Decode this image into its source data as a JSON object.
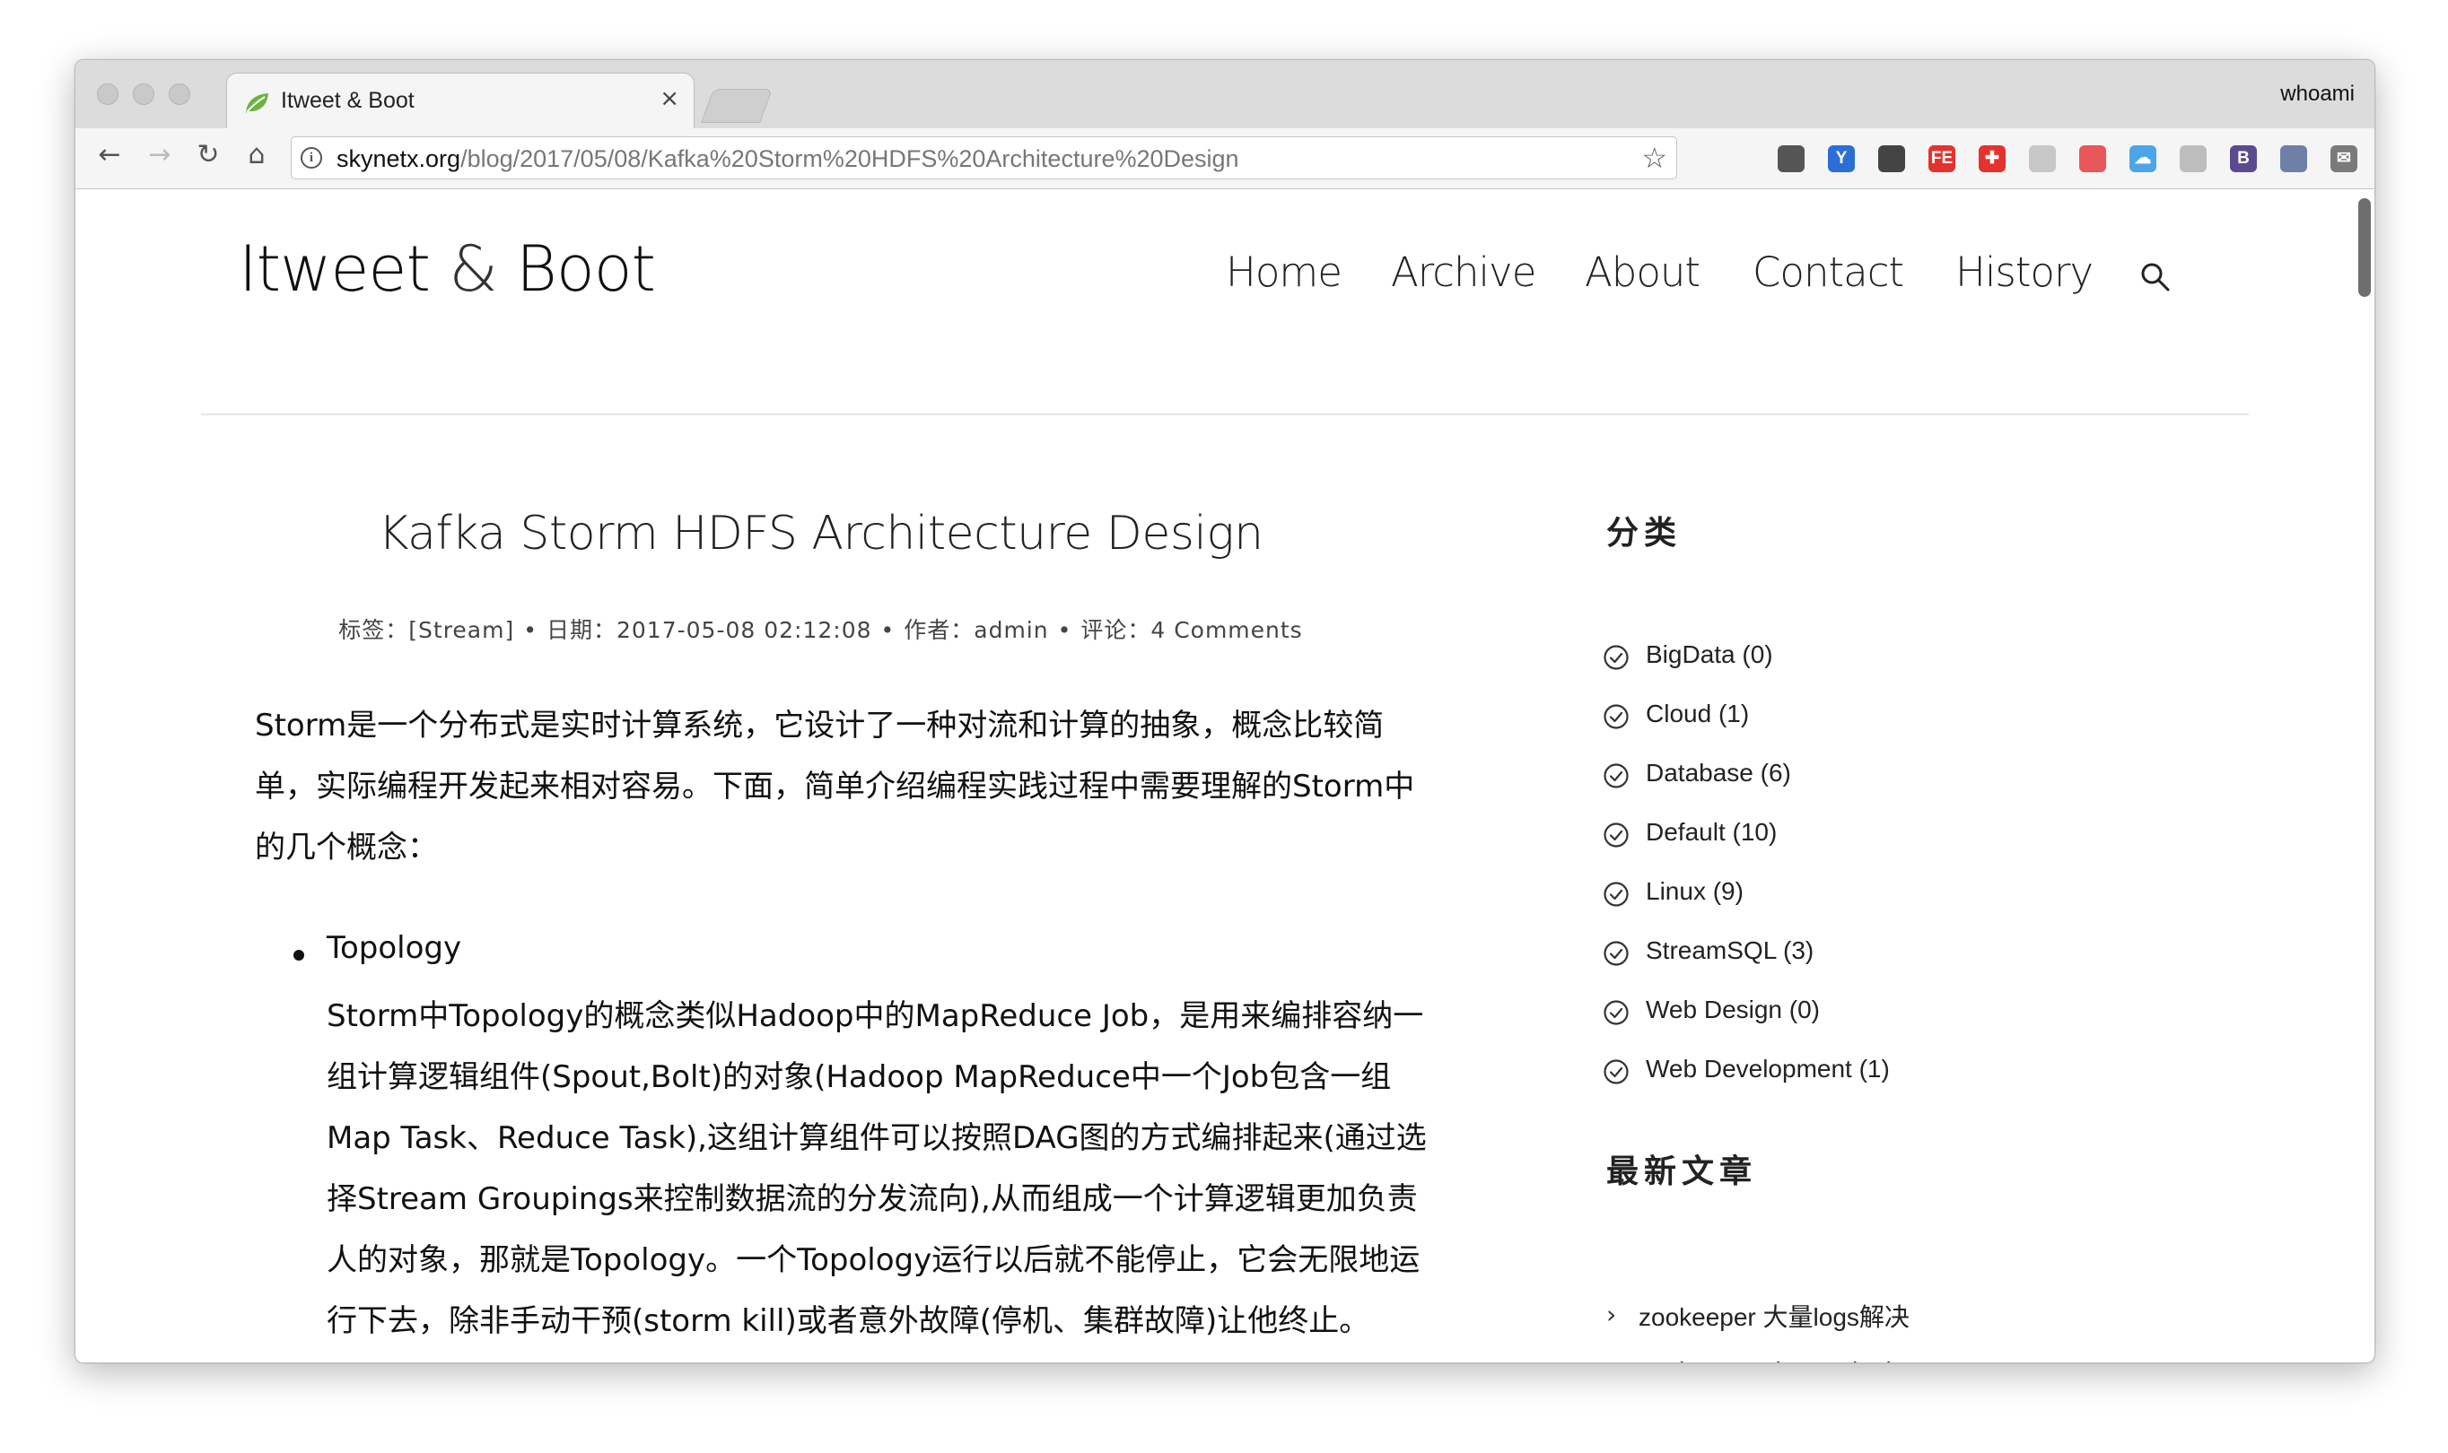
{
  "browser": {
    "tab_title": "Itweet & Boot",
    "tab_close": "×",
    "profile_name": "whoami",
    "url_host": "skynetx.org",
    "url_path": "/blog/2017/05/08/Kafka%20Storm%20HDFS%20Architecture%20Design",
    "back_glyph": "←",
    "forward_glyph": "→",
    "reload_glyph": "↻",
    "home_glyph": "⌂",
    "info_glyph": "i",
    "star_glyph": "☆",
    "extensions": [
      {
        "name": "pocket-extension-icon",
        "label": "",
        "color": "#555555"
      },
      {
        "name": "y-extension-icon",
        "label": "Y",
        "color": "#2b6fd6"
      },
      {
        "name": "evernote-extension-icon",
        "label": "",
        "color": "#444444"
      },
      {
        "name": "fe-extension-icon",
        "label": "FE",
        "color": "#e5322d"
      },
      {
        "name": "plus-extension-icon",
        "label": "✚",
        "color": "#e5322d"
      },
      {
        "name": "gear-extension-icon",
        "label": "",
        "color": "#c8c8c8"
      },
      {
        "name": "red-extension-icon",
        "label": "",
        "color": "#e8585a"
      },
      {
        "name": "cloud-extension-icon",
        "label": "☁",
        "color": "#4ba6e8"
      },
      {
        "name": "hand-extension-icon",
        "label": "",
        "color": "#bdbdbd"
      },
      {
        "name": "bootstrap-extension-icon",
        "label": "B",
        "color": "#5b4a8f"
      },
      {
        "name": "compass-extension-icon",
        "label": "",
        "color": "#6e7fa8"
      },
      {
        "name": "mail-extension-icon",
        "label": "✉",
        "color": "#7a7a7a"
      },
      {
        "name": "puzzle-extension-icon",
        "label": "",
        "color": "#d6d6d6"
      },
      {
        "name": "check-extension-icon",
        "label": "✓",
        "color": "#b5b5b5"
      },
      {
        "name": "update-extension-icon",
        "label": "↑",
        "color": "#f0a020"
      }
    ]
  },
  "site": {
    "logo_main": "Itweet",
    "logo_amp": "&",
    "logo_rest": "Boot",
    "nav": [
      "Home",
      "Archive",
      "About",
      "Contact",
      "History"
    ]
  },
  "post": {
    "title": "Kafka Storm HDFS Architecture Design",
    "meta": {
      "tags": "标签：[Stream]",
      "date": "日期：2017-05-08 02:12:08",
      "author": "作者：admin",
      "comments": "评论：4 Comments",
      "sep": "•"
    },
    "intro_lines": [
      "Storm是一个分布式是实时计算系统，它设计了一种对流和计算的抽象，概念比较简",
      "单，实际编程开发起来相对容易。下面，简单介绍编程实践过程中需要理解的Storm中",
      "的几个概念："
    ],
    "list_item": {
      "term": "Topology",
      "lines": [
        "Storm中Topology的概念类似Hadoop中的MapReduce Job，是用来编排容纳一",
        "组计算逻辑组件(Spout,Bolt)的对象(Hadoop MapReduce中一个Job包含一组",
        "Map Task、Reduce Task),这组计算组件可以按照DAG图的方式编排起来(通过选",
        "择Stream Groupings来控制数据流的分发流向),从而组成一个计算逻辑更加负责",
        "人的对象，那就是Topology。一个Topology运行以后就不能停止，它会无限地运",
        "行下去，除非手动干预(storm kill)或者意外故障(停机、集群故障)让他终止。"
      ]
    }
  },
  "sidebar": {
    "categories_heading": "分类",
    "categories": [
      "BigData (0)",
      "Cloud (1)",
      "Database (6)",
      "Default (10)",
      "Linux (9)",
      "StreamSQL (3)",
      "Web Design (0)",
      "Web Development (1)"
    ],
    "recent_heading": "最新文章",
    "recent_chevron": "›",
    "recent_posts": [
      "zookeeper 大量logs解决",
      "zookeeper cluster deploy"
    ]
  }
}
